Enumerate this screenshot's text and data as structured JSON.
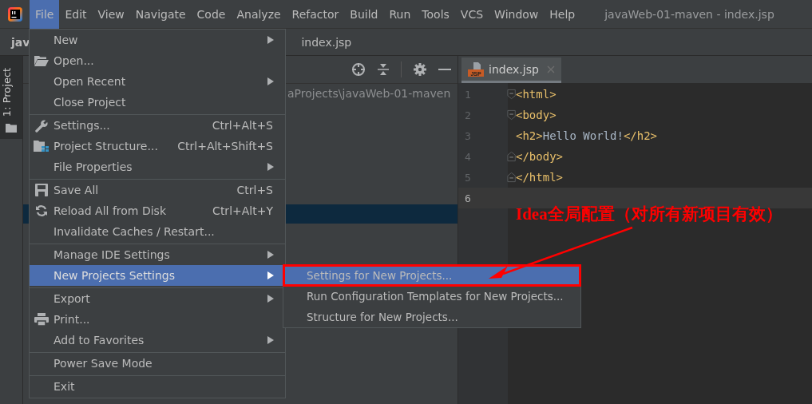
{
  "menubar": {
    "items": [
      {
        "label": "File",
        "selected": true
      },
      {
        "label": "Edit",
        "selected": false
      },
      {
        "label": "View",
        "selected": false
      },
      {
        "label": "Navigate",
        "selected": false
      },
      {
        "label": "Code",
        "selected": false
      },
      {
        "label": "Analyze",
        "selected": false
      },
      {
        "label": "Refactor",
        "selected": false
      },
      {
        "label": "Build",
        "selected": false
      },
      {
        "label": "Run",
        "selected": false
      },
      {
        "label": "Tools",
        "selected": false
      },
      {
        "label": "VCS",
        "selected": false
      },
      {
        "label": "Window",
        "selected": false
      },
      {
        "label": "Help",
        "selected": false
      }
    ],
    "title": "javaWeb-01-maven - index.jsp"
  },
  "navbar": {
    "breadcrumb": "jav",
    "file": "index.jsp"
  },
  "tool_window_strip": {
    "tab": "1: Project"
  },
  "project_panel": {
    "path": "aProjects\\javaWeb-01-maven"
  },
  "editor": {
    "tab": {
      "label": "index.jsp",
      "badge": "JSP"
    },
    "lines": [
      {
        "number": "1",
        "current": false,
        "tokens": [
          {
            "text": "<html>",
            "kind": "tag"
          }
        ]
      },
      {
        "number": "2",
        "current": false,
        "tokens": [
          {
            "text": "<body>",
            "kind": "tag"
          }
        ]
      },
      {
        "number": "3",
        "current": false,
        "tokens": [
          {
            "text": "<h2>",
            "kind": "tag"
          },
          {
            "text": "Hello World!",
            "kind": "text"
          },
          {
            "text": "</h2>",
            "kind": "tag"
          }
        ]
      },
      {
        "number": "4",
        "current": false,
        "tokens": [
          {
            "text": "</body>",
            "kind": "tag"
          }
        ]
      },
      {
        "number": "5",
        "current": false,
        "tokens": [
          {
            "text": "</html>",
            "kind": "tag"
          }
        ]
      },
      {
        "number": "6",
        "current": true
      }
    ]
  },
  "file_menu": {
    "items": [
      {
        "label": "New",
        "submenu": true,
        "selected": false,
        "separator_before": false
      },
      {
        "label": "Open...",
        "submenu": false,
        "selected": false,
        "separator_before": false
      },
      {
        "label": "Open Recent",
        "submenu": true,
        "selected": false,
        "separator_before": false
      },
      {
        "label": "Close Project",
        "submenu": false,
        "selected": false,
        "separator_before": false
      },
      {
        "label": "Settings...",
        "shortcut": "Ctrl+Alt+S",
        "submenu": false,
        "selected": false,
        "separator_before": true
      },
      {
        "label": "Project Structure...",
        "shortcut": "Ctrl+Alt+Shift+S",
        "submenu": false,
        "selected": false,
        "separator_before": false
      },
      {
        "label": "File Properties",
        "submenu": true,
        "selected": false,
        "separator_before": false
      },
      {
        "label": "Save All",
        "shortcut": "Ctrl+S",
        "submenu": false,
        "selected": false,
        "separator_before": true
      },
      {
        "label": "Reload All from Disk",
        "shortcut": "Ctrl+Alt+Y",
        "submenu": false,
        "selected": false,
        "separator_before": false
      },
      {
        "label": "Invalidate Caches / Restart...",
        "submenu": false,
        "selected": false,
        "separator_before": false
      },
      {
        "label": "Manage IDE Settings",
        "submenu": true,
        "selected": false,
        "separator_before": true
      },
      {
        "label": "New Projects Settings",
        "submenu": true,
        "selected": true,
        "separator_before": false
      },
      {
        "label": "Export",
        "submenu": true,
        "selected": false,
        "separator_before": true
      },
      {
        "label": "Print...",
        "submenu": false,
        "selected": false,
        "separator_before": false
      },
      {
        "label": "Add to Favorites",
        "submenu": true,
        "selected": false,
        "separator_before": false
      },
      {
        "label": "Power Save Mode",
        "submenu": false,
        "selected": false,
        "separator_before": true
      },
      {
        "label": "Exit",
        "submenu": false,
        "selected": false,
        "separator_before": true
      }
    ]
  },
  "submenu": {
    "items": [
      {
        "label": "Settings for New Projects...",
        "selected": true,
        "boxed": true
      },
      {
        "label": "Run Configuration Templates for New Projects...",
        "selected": false,
        "boxed": false
      },
      {
        "label": "Structure for New Projects...",
        "selected": false,
        "boxed": false
      }
    ]
  },
  "annotation": {
    "text": "Idea全局配置（对所有新项目有效）"
  }
}
